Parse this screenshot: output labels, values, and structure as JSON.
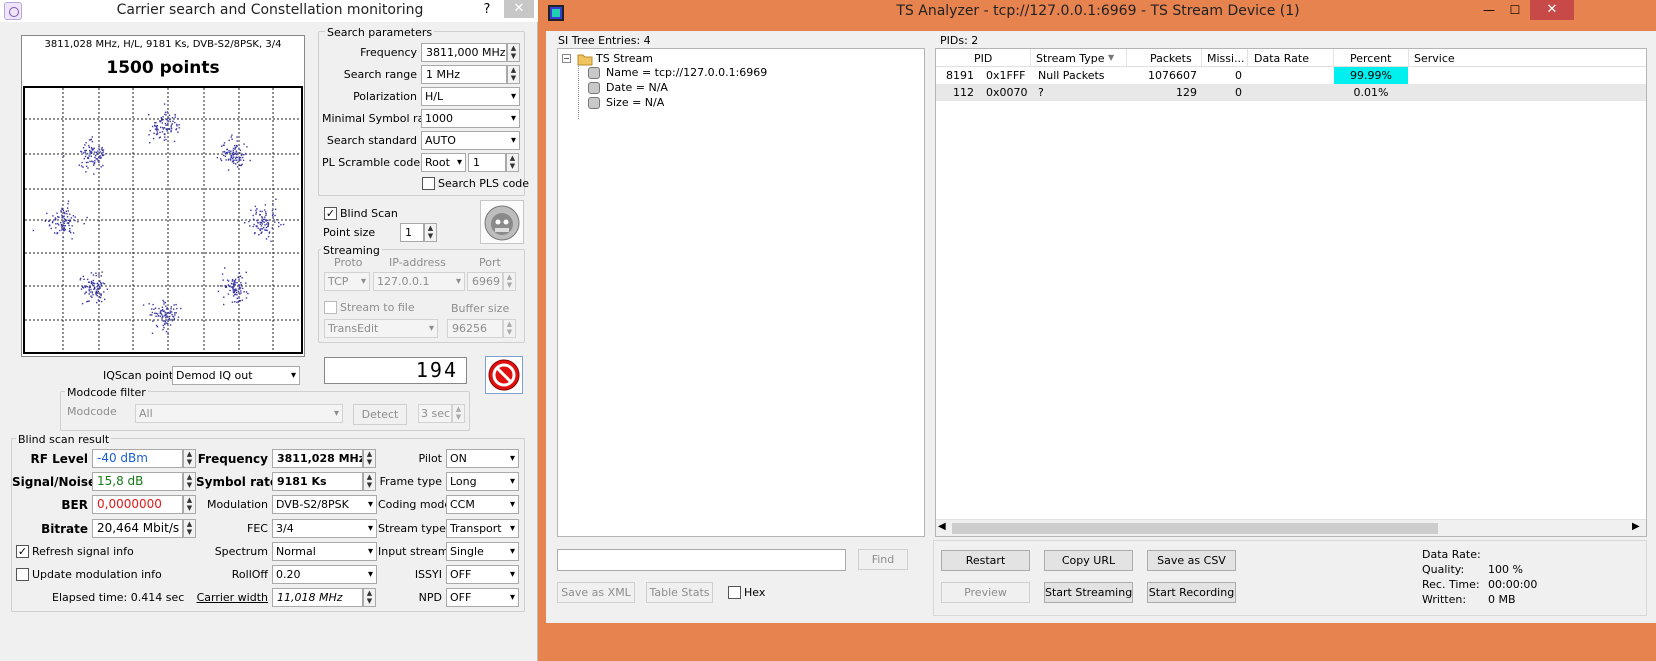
{
  "left_window": {
    "title": "Carrier search and Constellation monitoring",
    "help_label": "?",
    "close_label": "✕",
    "constellation": {
      "info": "3811,028 MHz, H/L, 9181 Ks, DVB-S2/8PSK, 3/4",
      "points_label": "1500 points"
    },
    "search_params": {
      "group_label": "Search parameters",
      "frequency_label": "Frequency",
      "frequency_value": "3811,000 MHz",
      "range_label": "Search range",
      "range_value": "1 MHz",
      "polarization_label": "Polarization",
      "polarization_value": "H/L",
      "symrate_label": "Minimal Symbol rate",
      "symrate_value": "1000",
      "standard_label": "Search standard",
      "standard_value": "AUTO",
      "pl_label": "PL Scramble code",
      "pl_mode": "Root",
      "pl_value": "1",
      "search_pls_label": "Search PLS code"
    },
    "blind_scan_label": "Blind Scan",
    "point_size_label": "Point size",
    "point_size_value": "1",
    "streaming": {
      "group_label": "Streaming",
      "proto_label": "Proto",
      "ip_label": "IP-address",
      "port_label": "Port",
      "proto_value": "TCP",
      "ip_value": "127.0.0.1",
      "port_value": "6969",
      "stream_to_file_label": "Stream to file",
      "buffer_label": "Buffer size",
      "target_value": "TransEdit",
      "buffer_value": "96256"
    },
    "counter": "194",
    "iqscan_label": "IQScan point",
    "iqscan_value": "Demod IQ out",
    "modcode": {
      "group_label": "Modcode filter",
      "label": "Modcode",
      "value": "All",
      "detect_label": "Detect",
      "interval_value": "3 sec"
    },
    "result": {
      "group_label": "Blind scan result",
      "rf_label": "RF Level",
      "rf_value": "-40 dBm",
      "snr_label": "Signal/Noise",
      "snr_value": "15,8 dB",
      "ber_label": "BER",
      "ber_value": "0,0000000",
      "bitrate_label": "Bitrate",
      "bitrate_value": "20,464 Mbit/s",
      "freq_label": "Frequency",
      "freq_value": "3811,028 MHz",
      "sr_label": "Symbol rate",
      "sr_value": "9181 Ks",
      "mod_label": "Modulation",
      "mod_value": "DVB-S2/8PSK",
      "fec_label": "FEC",
      "fec_value": "3/4",
      "spectrum_label": "Spectrum",
      "spectrum_value": "Normal",
      "rolloff_label": "RollOff",
      "rolloff_value": "0.20",
      "cw_label": "Carrier width",
      "cw_value": "11,018 MHz",
      "pilot_label": "Pilot",
      "pilot_value": "ON",
      "frame_label": "Frame type",
      "frame_value": "Long",
      "coding_label": "Coding mode",
      "coding_value": "CCM",
      "stype_label": "Stream type",
      "stype_value": "Transport",
      "istream_label": "Input stream",
      "istream_value": "Single",
      "issyi_label": "ISSYI",
      "issyi_value": "OFF",
      "npd_label": "NPD",
      "npd_value": "OFF"
    },
    "refresh_label": "Refresh signal info",
    "update_label": "Update modulation info",
    "elapsed": "Elapsed time: 0.414 sec"
  },
  "right_window": {
    "title": "TS Analyzer - tcp://127.0.0.1:6969 - TS Stream Device (1)",
    "minimize_label": "—",
    "maximize_label": "☐",
    "close_label": "✕",
    "si_header": "SI Tree Entries: 4",
    "tree": {
      "root": "TS Stream",
      "items": [
        "Name = tcp://127.0.0.1:6969",
        "Date = N/A",
        "Size = N/A"
      ]
    },
    "pids_header": "PIDs: 2",
    "columns": [
      "PID",
      "Stream Type",
      "Packets",
      "Missi...",
      "Data Rate",
      "Percent",
      "Service"
    ],
    "rows": [
      {
        "pid": "8191",
        "hex": "0x1FFF",
        "type": "Null Packets",
        "packets": "1076607",
        "missing": "0",
        "rate": "",
        "percent": "99.99%",
        "service": ""
      },
      {
        "pid": "112",
        "hex": "0x0070",
        "type": "?",
        "packets": "129",
        "missing": "0",
        "rate": "",
        "percent": "0.01%",
        "service": ""
      }
    ],
    "find_label": "Find",
    "save_xml_label": "Save as XML",
    "table_stats_label": "Table Stats",
    "hex_label": "Hex",
    "buttons": {
      "restart": "Restart",
      "copy_url": "Copy URL",
      "save_csv": "Save as CSV",
      "preview": "Preview",
      "start_streaming": "Start Streaming",
      "start_recording": "Start Recording"
    },
    "stats": {
      "rate_label": "Data Rate:",
      "rate_value": "",
      "quality_label": "Quality:",
      "quality_value": "100 %",
      "rec_label": "Rec. Time:",
      "rec_value": "00:00:00",
      "written_label": "Written:",
      "written_value": "0 MB"
    }
  }
}
